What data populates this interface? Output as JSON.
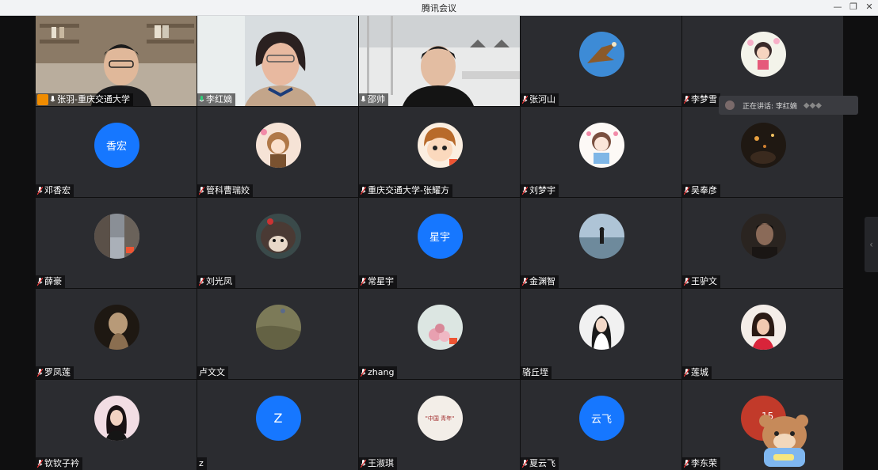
{
  "window": {
    "title": "腾讯会议",
    "minimize_icon": "minimize-icon",
    "restore_icon": "restore-icon",
    "close_icon": "close-icon"
  },
  "speaking": {
    "label": "正在讲话: 李红嫡"
  },
  "participants": [
    {
      "name": "张羽-重庆交通大学",
      "video": true
    },
    {
      "name": "李红嫡",
      "video": true
    },
    {
      "name": "邵帅",
      "video": true
    },
    {
      "name": "张河山",
      "avatar": "eagle"
    },
    {
      "name": "李梦雪",
      "avatar": "cartoon-girl"
    },
    {
      "name": "邓香宏",
      "avatar_text": "香宏"
    },
    {
      "name": "管科曹瑞姣",
      "avatar": "anime-girl"
    },
    {
      "name": "重庆交通大学-张耀方",
      "avatar": "cartoon-face"
    },
    {
      "name": "刘梦宇",
      "avatar": "chibi"
    },
    {
      "name": "吴奉彦",
      "avatar": "night-photo"
    },
    {
      "name": "薛豪",
      "avatar": "street-photo"
    },
    {
      "name": "刘光凤",
      "avatar": "hedgehog"
    },
    {
      "name": "常星宇",
      "avatar_text": "星宇"
    },
    {
      "name": "金渊智",
      "avatar": "beach"
    },
    {
      "name": "王驴文",
      "avatar": "dark-portrait"
    },
    {
      "name": "罗凤莲",
      "avatar": "statue"
    },
    {
      "name": "卢文文",
      "avatar": "field"
    },
    {
      "name": "zhang",
      "avatar": "flowers"
    },
    {
      "name": "骆丘垤",
      "avatar": "white-dress"
    },
    {
      "name": "莲城",
      "avatar": "woman-red"
    },
    {
      "name": "钦钦子衿",
      "avatar": "selfie"
    },
    {
      "name": "z",
      "avatar_text": "Z"
    },
    {
      "name": "王淑琪",
      "avatar_text": "\"中国 青年\""
    },
    {
      "name": "夏云飞",
      "avatar_text": "云飞"
    },
    {
      "name": "李东荣",
      "avatar": "number-15"
    }
  ],
  "colors": {
    "tile_bg": "#2b2c30",
    "avatar_blue": "#1677ff",
    "active_border": "#2fa37a"
  }
}
